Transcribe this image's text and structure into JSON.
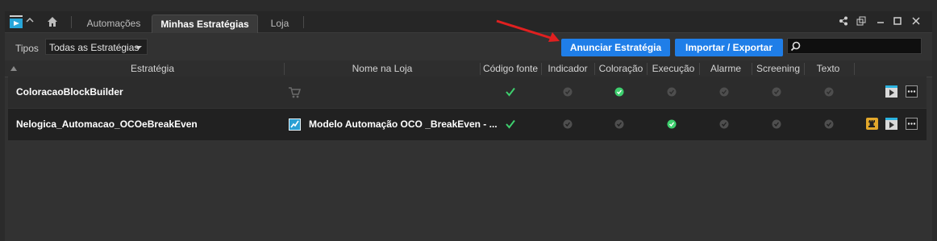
{
  "tabs": [
    {
      "label": "Automações"
    },
    {
      "label": "Minhas Estratégias"
    },
    {
      "label": "Loja"
    }
  ],
  "toolbar": {
    "tipos_label": "Tipos",
    "tipos_value": "Todas as Estratégias",
    "announce_label": "Anunciar Estratégia",
    "import_label": "Importar / Exportar",
    "search_placeholder": ""
  },
  "columns": {
    "estrategia": "Estratégia",
    "nome_loja": "Nome na Loja",
    "codigo": "Código fonte",
    "indicador": "Indicador",
    "coloracao": "Coloração",
    "execucao": "Execução",
    "alarme": "Alarme",
    "screening": "Screening",
    "texto": "Texto"
  },
  "rows": [
    {
      "name": "ColoracaoBlockBuilder",
      "store_name": "",
      "store_icon": "cart-icon",
      "codigo": true,
      "indicador": false,
      "coloracao": true,
      "execucao": false,
      "alarme": false,
      "screening": false,
      "texto": false
    },
    {
      "name": "Nelogica_Automacao_OCOeBreakEven",
      "store_name": "Modelo Automação OCO _BreakEven - ...",
      "store_icon": "store-strategy-icon",
      "codigo": true,
      "indicador": false,
      "coloracao": false,
      "execucao": true,
      "alarme": false,
      "screening": false,
      "texto": false
    }
  ],
  "colors": {
    "accent": "#1f7ee8",
    "check": "#3ecf6e",
    "annotation_arrow": "#e02020"
  }
}
